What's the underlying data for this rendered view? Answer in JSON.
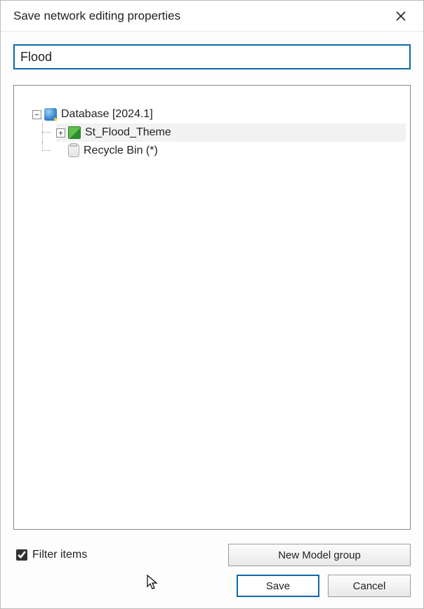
{
  "dialog": {
    "title": "Save network editing properties"
  },
  "input": {
    "value": "Flood"
  },
  "tree": {
    "root": {
      "label": "Database [2024.1]",
      "expander": "−"
    },
    "theme": {
      "label": "St_Flood_Theme",
      "expander": "+"
    },
    "bin": {
      "label": "Recycle Bin (*)"
    }
  },
  "filter": {
    "label": "Filter items",
    "checked": true
  },
  "buttons": {
    "new_group": "New Model group",
    "save": "Save",
    "cancel": "Cancel"
  }
}
